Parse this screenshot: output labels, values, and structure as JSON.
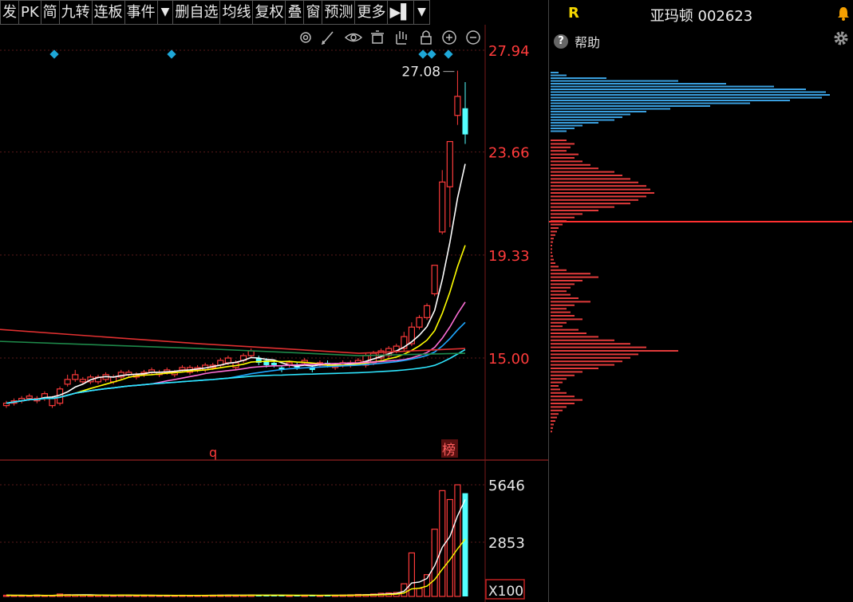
{
  "toolbar": {
    "items": [
      "发",
      "PK",
      "简",
      "九转",
      "连板",
      "事件",
      "▼",
      "删自选",
      "均线",
      "复权",
      "叠",
      "窗",
      "预测",
      "更多",
      "▶▌",
      "▼"
    ]
  },
  "chart": {
    "price_labels": [
      "27.94",
      "23.66",
      "19.33",
      "15.00"
    ],
    "max_price_label": "27.08",
    "volume_labels": [
      "5646",
      "2853"
    ],
    "volume_unit": "X100",
    "event_marker_q": "q",
    "event_marker_bang": "榜",
    "colors": {
      "up": "#ff3b3b",
      "down": "#54ffff",
      "grid": "#5a1a1a",
      "axis_text": "#ff3b3b",
      "ma5": "#ffffff",
      "ma10": "#ffff00",
      "ma20": "#ff6fd8",
      "ma30": "#1ea8ff",
      "ma60": "#2ee6ff",
      "ma120": "#1e8a4a",
      "ma250": "#e03030"
    }
  },
  "panel": {
    "badge": "R",
    "title": "亚玛顿 002623",
    "help_label": "帮助"
  },
  "chart_data": {
    "type": "candlestick",
    "x": [
      1,
      2,
      3,
      4,
      5,
      6,
      7,
      8,
      9,
      10,
      11,
      12,
      13,
      14,
      15,
      16,
      17,
      18,
      19,
      20,
      21,
      22,
      23,
      24,
      25,
      26,
      27,
      28,
      29,
      30,
      31,
      32,
      33,
      34,
      35,
      36,
      37,
      38,
      39,
      40,
      41,
      42,
      43,
      44,
      45,
      46,
      47,
      48,
      49,
      50,
      51,
      52,
      53,
      54,
      55,
      56,
      57,
      58,
      59,
      60,
      61
    ],
    "open": [
      13.0,
      13.1,
      13.2,
      13.3,
      13.2,
      13.3,
      13.0,
      13.1,
      13.9,
      14.1,
      14.0,
      14.0,
      14.0,
      14.1,
      14.0,
      14.2,
      14.3,
      14.2,
      14.3,
      14.4,
      14.3,
      14.4,
      14.3,
      14.5,
      14.4,
      14.5,
      14.5,
      14.6,
      14.7,
      14.8,
      14.6,
      14.9,
      15.1,
      15.0,
      14.9,
      14.8,
      14.6,
      14.7,
      14.7,
      14.8,
      14.6,
      14.7,
      14.8,
      14.6,
      14.7,
      14.7,
      14.8,
      14.7,
      14.8,
      15.0,
      15.1,
      15.3,
      15.4,
      15.6,
      16.3,
      16.7,
      17.7,
      20.3,
      22.2,
      25.2,
      25.5
    ],
    "close": [
      13.1,
      13.2,
      13.3,
      13.4,
      13.3,
      13.5,
      13.3,
      13.7,
      14.1,
      14.3,
      14.1,
      14.2,
      14.2,
      14.3,
      14.2,
      14.4,
      14.4,
      14.3,
      14.4,
      14.5,
      14.4,
      14.5,
      14.4,
      14.6,
      14.6,
      14.6,
      14.7,
      14.7,
      14.9,
      15.0,
      14.8,
      15.1,
      15.3,
      14.8,
      14.7,
      14.7,
      14.5,
      14.8,
      14.6,
      14.9,
      14.5,
      14.8,
      14.7,
      14.7,
      14.8,
      14.8,
      14.9,
      15.1,
      15.2,
      15.3,
      15.4,
      15.5,
      15.9,
      16.3,
      16.7,
      17.2,
      18.9,
      22.4,
      24.1,
      26.0,
      24.4
    ],
    "high": [
      13.2,
      13.3,
      13.4,
      13.5,
      13.4,
      13.6,
      13.4,
      13.8,
      14.3,
      14.5,
      14.2,
      14.3,
      14.3,
      14.4,
      14.3,
      14.5,
      14.5,
      14.4,
      14.5,
      14.6,
      14.5,
      14.6,
      14.5,
      14.7,
      14.7,
      14.7,
      14.8,
      14.8,
      15.0,
      15.1,
      14.9,
      15.2,
      15.4,
      15.1,
      15.0,
      14.9,
      14.7,
      14.9,
      14.8,
      15.0,
      14.7,
      14.9,
      14.9,
      14.8,
      14.9,
      14.9,
      15.0,
      15.2,
      15.3,
      15.4,
      15.5,
      15.6,
      16.1,
      16.5,
      16.8,
      17.3,
      18.9,
      22.9,
      24.1,
      27.08,
      26.6
    ],
    "low": [
      12.9,
      13.0,
      13.1,
      13.2,
      13.1,
      13.2,
      12.9,
      13.0,
      13.8,
      14.0,
      13.9,
      13.9,
      13.9,
      14.0,
      13.9,
      14.1,
      14.2,
      14.1,
      14.2,
      14.3,
      14.2,
      14.3,
      14.2,
      14.4,
      14.3,
      14.4,
      14.4,
      14.5,
      14.6,
      14.7,
      14.5,
      14.8,
      15.0,
      14.7,
      14.6,
      14.6,
      14.4,
      14.6,
      14.5,
      14.7,
      14.4,
      14.6,
      14.6,
      14.5,
      14.6,
      14.6,
      14.7,
      14.6,
      14.7,
      14.9,
      15.0,
      15.2,
      15.3,
      15.5,
      16.2,
      16.6,
      17.6,
      20.2,
      20.5,
      24.8,
      24.0
    ],
    "volume": [
      60,
      55,
      50,
      45,
      70,
      40,
      50,
      120,
      90,
      80,
      60,
      50,
      55,
      60,
      50,
      70,
      60,
      45,
      55,
      60,
      40,
      50,
      45,
      60,
      50,
      55,
      50,
      60,
      70,
      65,
      60,
      60,
      70,
      60,
      55,
      50,
      60,
      50,
      55,
      60,
      50,
      50,
      60,
      60,
      70,
      80,
      100,
      90,
      120,
      160,
      180,
      200,
      640,
      2200,
      400,
      1100,
      3400,
      5350,
      4900,
      5646,
      5220
    ],
    "price_axis_ticks": [
      27.94,
      23.66,
      19.33,
      15.0
    ],
    "volume_axis_ticks": [
      5646,
      2853
    ],
    "max_price": 27.08,
    "ylim": [
      11.6,
      28.6
    ]
  }
}
